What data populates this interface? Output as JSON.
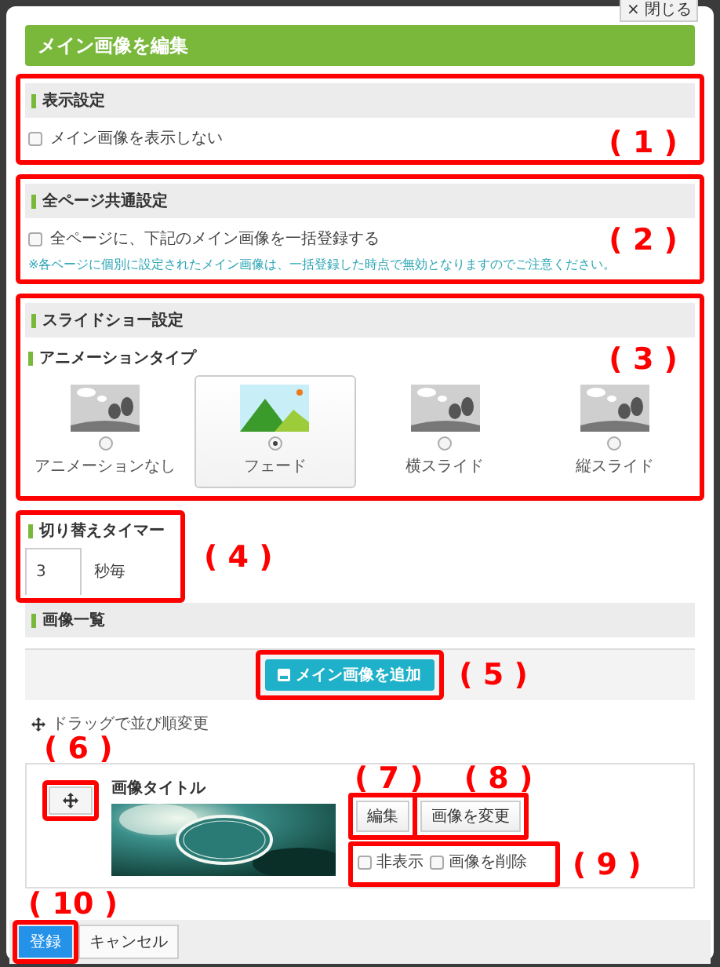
{
  "close_button": "× 閉じる",
  "title": "メイン画像を編集",
  "display_section": {
    "heading": "表示設定",
    "option": {
      "label": "メイン画像を表示しない",
      "checked": false
    },
    "callout": "( 1 )"
  },
  "common_section": {
    "heading": "全ページ共通設定",
    "option": {
      "label": "全ページに、下記のメイン画像を一括登録する",
      "checked": false
    },
    "note": "※各ページに個別に設定されたメイン画像は、一括登録した時点で無効となりますのでご注意ください。",
    "callout": "( 2 )"
  },
  "slideshow_section": {
    "heading": "スライドショー設定",
    "subheading": "アニメーションタイプ",
    "callout": "( 3 )",
    "options": [
      {
        "label": "アニメーションなし",
        "selected": false
      },
      {
        "label": "フェード",
        "selected": true
      },
      {
        "label": "横スライド",
        "selected": false
      },
      {
        "label": "縦スライド",
        "selected": false
      }
    ]
  },
  "timer": {
    "heading": "切り替えタイマー",
    "value": "3",
    "unit": "秒毎",
    "callout": "( 4 )"
  },
  "image_list": {
    "heading": "画像一覧",
    "add_button": "メイン画像を追加",
    "add_callout": "( 5 )",
    "drag_hint": "ドラッグで並び順変更",
    "item": {
      "kind": "picture",
      "title": "画像タイトル",
      "move_callout": "( 6 )",
      "edit_button": "編集",
      "edit_callout": "( 7 )",
      "change_button": "画像を変更",
      "change_callout": "( 8 )",
      "options": [
        {
          "label": "非表示",
          "checked": false
        },
        {
          "label": "画像を削除",
          "checked": false
        }
      ],
      "options_callout": "( 9 )"
    }
  },
  "footer": {
    "register_button": "登録",
    "register_callout": "( 10 )",
    "cancel_button": "キャンセル"
  }
}
